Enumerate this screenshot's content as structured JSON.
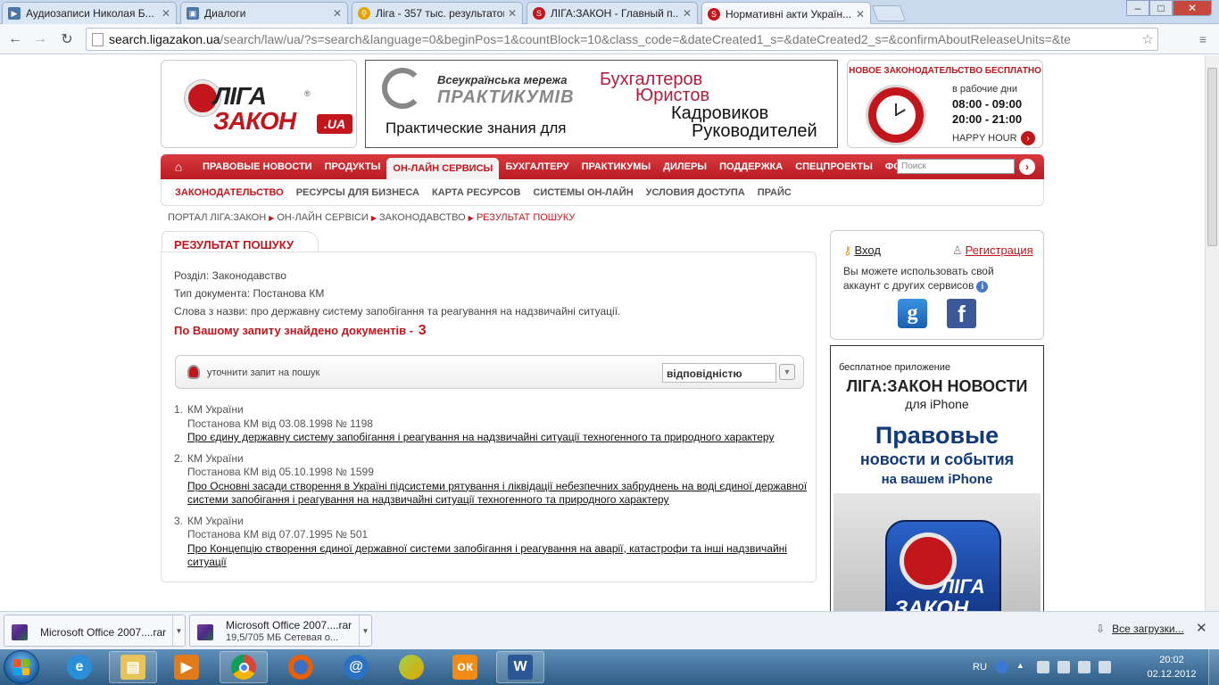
{
  "browser": {
    "tabs": [
      {
        "title": "Аудиозаписи Николая Б...",
        "icon": "vk-icon",
        "color": "#4a76a8"
      },
      {
        "title": "Диалоги",
        "icon": "vk-icon",
        "color": "#4a76a8"
      },
      {
        "title": "Ліга - 357 тыс. результатов",
        "icon": "google-search-icon",
        "color": "#e4a400"
      },
      {
        "title": "ЛІГА:ЗАКОН - Главный п...",
        "icon": "liga-icon",
        "color": "#c3161c"
      },
      {
        "title": "Нормативні акти Україн...",
        "icon": "liga-icon",
        "color": "#c3161c"
      }
    ],
    "active_tab": 4,
    "url_host": "search.ligazakon.ua",
    "url_path": "/search/law/ua/?s=search&language=0&beginPos=1&countBlock=10&class_code=&dateCreated1_s=&dateCreated2_s=&confirmAboutReleaseUnits=&te",
    "window_controls": {
      "minimize": "–",
      "maximize": "□",
      "close": "✕"
    },
    "nav": {
      "back": "←",
      "forward": "→",
      "reload": "↻",
      "star": "☆",
      "menu": "≡"
    }
  },
  "header": {
    "logo_top": "ЛІГА",
    "logo_bottom": "ЗАКОН",
    "logo_tld": ".UA",
    "logo_reg": "®",
    "banner": {
      "network": "Всеукраїнська мережа",
      "brand": "ПРАКТИКУМІВ",
      "tagline": "Практические знания для",
      "words": [
        "Бухгалтеров",
        "Юристов",
        "Кадровиков",
        "Руководителей"
      ]
    },
    "happy": {
      "title": "НОВОЕ ЗАКОНОДАТЕЛЬСТВО БЕСПЛАТНО",
      "weekdays": "в рабочие дни",
      "time1": "08:00 - 09:00",
      "time2": "20:00 - 21:00",
      "label": "HAPPY HOUR",
      "btn": "›"
    }
  },
  "mainnav": {
    "home": "⌂",
    "items": [
      "ПРАВОВЫЕ НОВОСТИ",
      "ПРОДУКТЫ",
      "ОН-ЛАЙН СЕРВИСЫ",
      "БУХГАЛТЕРУ",
      "ПРАКТИКУМЫ",
      "ДИЛЕРЫ",
      "ПОДДЕРЖКА",
      "СПЕЦПРОЕКТЫ",
      "ФОРУМ"
    ],
    "active": 2,
    "search_placeholder": "Поиск",
    "go": "›"
  },
  "subnav": {
    "items": [
      "ЗАКОНОДАТЕЛЬСТВО",
      "РЕСУРСЫ ДЛЯ БИЗНЕСА",
      "КАРТА РЕСУРСОВ",
      "СИСТЕМЫ ОН-ЛАЙН",
      "УСЛОВИЯ ДОСТУПА",
      "ПРАЙС"
    ],
    "active": 0
  },
  "breadcrumb": {
    "items": [
      "ПОРТАЛ ЛІГА:ЗАКОН",
      "ОН-ЛАЙН СЕРВІСИ",
      "ЗАКОНОДАВСТВО"
    ],
    "current": "РЕЗУЛЬТАТ ПОШУКУ",
    "sep": "▶"
  },
  "result": {
    "tab_title": "РЕЗУЛЬТАТ ПОШУКУ",
    "section": "Розділ: Законодавство",
    "doctype": "Тип документа: Постанова КМ",
    "words": "Слова з назви: про державну систему запобігання та реагування на надзвичайні ситуації.",
    "found_label": "По Вашому запиту знайдено документів -",
    "found_count": "3",
    "refine_label": "уточнити запит на пошук",
    "sort_value": "відповідністю",
    "sort_arrow": "▼",
    "items": [
      {
        "n": "1.",
        "issuer": "КМ України",
        "doc": "Постанова КМ від 03.08.1998 № 1198",
        "title": "Про єдину державну систему запобігання і реагування на надзвичайні ситуації техногенного та природного характеру"
      },
      {
        "n": "2.",
        "issuer": "КМ України",
        "doc": "Постанова КМ від 05.10.1998 № 1599",
        "title": "Про Основні засади створення в Україні підсистеми рятування і ліквідації небезпечних забруднень на воді єдиної державної системи запобігання і реагування на надзвичайні ситуації техногенного та природного характеру"
      },
      {
        "n": "3.",
        "issuer": "КМ України",
        "doc": "Постанова КМ від 07.07.1995 № 501",
        "title": "Про Концепцію створення єдиної державної системи запобігання і реагування на аварії, катастрофи та інші надзвичайні ситуації"
      }
    ]
  },
  "login": {
    "login_label": "Вход",
    "register_label": "Регистрация",
    "text": "Вы можете использовать свой аккаунт с других сервисов",
    "info": "i",
    "google": "g",
    "facebook": "f"
  },
  "promo": {
    "line1": "бесплатное приложение",
    "line2": "ЛІГА:ЗАКОН НОВОСТИ",
    "line3": "для iPhone",
    "line4": "Правовые",
    "line5": "новости и события",
    "line6": "на вашем iPhone",
    "app_t1": "ЛІГА",
    "app_t2": "ЗАКОН"
  },
  "downloads": {
    "items": [
      {
        "name": "Microsoft Office 2007....rar",
        "status": ""
      },
      {
        "name": "Microsoft Office 2007....rar",
        "status": "19,5/705 МБ Сетевая о..."
      }
    ],
    "all_label": "Все загрузки...",
    "close": "✕"
  },
  "taskbar": {
    "apps": [
      "Internet Explorer",
      "Windows Explorer",
      "Media Player",
      "Google Chrome",
      "Firefox",
      "Mail",
      "Green App",
      "Odnoklassniki",
      "Word"
    ],
    "lang": "RU",
    "time": "20:02",
    "date": "02.12.2012"
  }
}
